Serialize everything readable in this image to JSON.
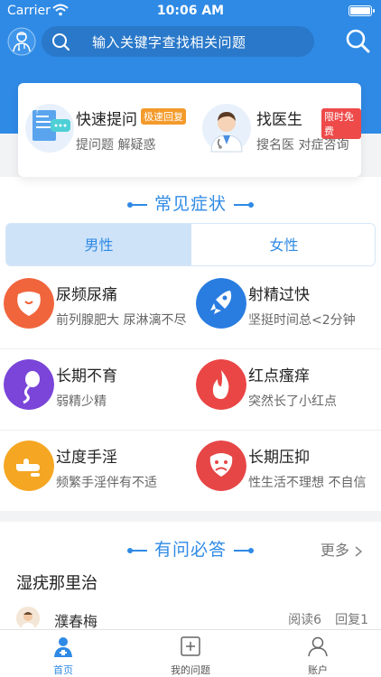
{
  "status_bar": {
    "carrier": "Carrier",
    "time": "10:06 AM"
  },
  "search": {
    "placeholder": "输入关键字查找相关问题"
  },
  "quick_actions": [
    {
      "title": "快速提问",
      "badge": "极速回复",
      "subtitle": "提问题 解疑惑"
    },
    {
      "title": "找医生",
      "badge": "限时免费",
      "subtitle": "搜名医 对症咨询"
    }
  ],
  "symptoms_section": {
    "title": "常见症状"
  },
  "gender_tabs": {
    "male": "男性",
    "female": "女性",
    "selected": "男性"
  },
  "symptoms": [
    {
      "name": "尿频尿痛",
      "desc": "前列腺肥大 尿淋漓不尽",
      "color": "#f0653c"
    },
    {
      "name": "射精过快",
      "desc": "坚挺时间总<2分钟",
      "color": "#2a7de0"
    },
    {
      "name": "长期不育",
      "desc": "弱精少精",
      "color": "#7a45d8"
    },
    {
      "name": "红点瘙痒",
      "desc": "突然长了小红点",
      "color": "#ea4646"
    },
    {
      "name": "过度手淫",
      "desc": "频繁手淫伴有不适",
      "color": "#f5a623"
    },
    {
      "name": "长期压抑",
      "desc": "性生活不理想 不自信",
      "color": "#e64646"
    }
  ],
  "qa_section": {
    "title": "有问必答",
    "more": "更多",
    "question_title": "湿疣那里治",
    "answerer": "濮春梅",
    "reads": "阅读6",
    "replies": "回复1"
  },
  "tabs": [
    {
      "label": "首页",
      "active": true
    },
    {
      "label": "我的问题",
      "active": false
    },
    {
      "label": "账户",
      "active": false
    }
  ],
  "colors": {
    "primary": "#2f8ae5",
    "badge_orange": "#f39a2b",
    "badge_red": "#ee4a4a"
  }
}
